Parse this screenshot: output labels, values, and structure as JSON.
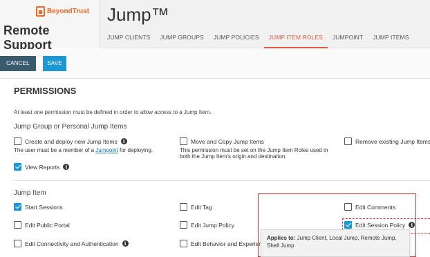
{
  "header": {
    "logo_brand": "BeyondTrust",
    "logo_product": "Remote Support",
    "app_title": "Jump™",
    "tabs": [
      {
        "label": "JUMP CLIENTS",
        "active": false
      },
      {
        "label": "JUMP GROUPS",
        "active": false
      },
      {
        "label": "JUMP POLICIES",
        "active": false
      },
      {
        "label": "JUMP ITEM ROLES",
        "active": true
      },
      {
        "label": "JUMPOINT",
        "active": false
      },
      {
        "label": "JUMP ITEMS",
        "active": false
      }
    ]
  },
  "toolbar": {
    "cancel_label": "CANCEL",
    "save_label": "SAVE"
  },
  "permissions": {
    "title": "PERMISSIONS",
    "note": "At least one permission must be defined in order to allow access to a Jump Item.",
    "group1": {
      "heading": "Jump Group or Personal Jump Items",
      "create_label": "Create and deploy new Jump Items",
      "create_checked": false,
      "create_sub_prefix": "The user must be a member of a ",
      "create_sub_link": "Jumpoint",
      "create_sub_suffix": " for deploying.",
      "move_label": "Move and Copy Jump Items",
      "move_checked": false,
      "move_sub_line1": "This permission must be set on the Jump Item Roles used in",
      "move_sub_line2": "both the Jump Item's origin and destination.",
      "remove_label": "Remove existing Jump Items",
      "remove_checked": false,
      "view_reports_label": "View Reports",
      "view_reports_checked": true
    },
    "group2": {
      "heading": "Jump Item",
      "start_sessions_label": "Start Sessions",
      "start_sessions_checked": true,
      "edit_tag_label": "Edit Tag",
      "edit_tag_checked": false,
      "edit_comments_label": "Edit Comments",
      "edit_comments_checked": false,
      "edit_public_portal_label": "Edit Public Portal",
      "edit_public_portal_checked": false,
      "edit_jump_policy_label": "Edit Jump Policy",
      "edit_jump_policy_checked": false,
      "edit_session_policy_label": "Edit Session Policy",
      "edit_session_policy_checked": true,
      "edit_connectivity_label": "Edit Connectivity and Authentication",
      "edit_connectivity_checked": false,
      "edit_behavior_label": "Edit Behavior and Experienc",
      "edit_behavior_checked": false
    },
    "tooltip": {
      "prefix": "Applies to:",
      "text": " Jump Client, Local Jump, Remote Jump, Shell Jump"
    }
  },
  "colors": {
    "accent": "#1b98d6",
    "active_tab": "#e8563a",
    "cancel_button": "#3a5a6e",
    "highlight": "#e03030",
    "brand": "#f26522"
  }
}
